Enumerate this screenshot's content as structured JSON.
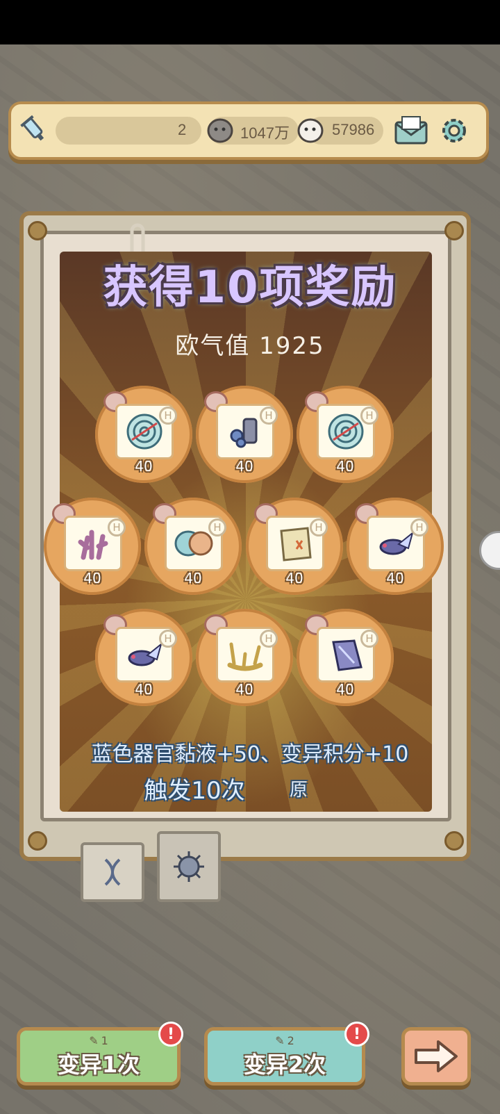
{
  "topbar": {
    "items_count": "2",
    "coins": "1047万",
    "gems": "57986"
  },
  "reward_panel": {
    "title": "获得10项奖励",
    "luck_label": "欧气值 1925",
    "rewards": [
      {
        "item": "maze-organ-icon",
        "count": "40"
      },
      {
        "item": "tree-stump-mushroom-icon",
        "count": "40"
      },
      {
        "item": "maze-organ-icon",
        "count": "40"
      },
      {
        "item": "coral-icon",
        "count": "40"
      },
      {
        "item": "brain-icon",
        "count": "40"
      },
      {
        "item": "map-scroll-icon",
        "count": "40"
      },
      {
        "item": "winged-fish-icon",
        "count": "40"
      },
      {
        "item": "winged-fish-icon",
        "count": "40"
      },
      {
        "item": "antler-icon",
        "count": "40"
      },
      {
        "item": "crystal-shard-icon",
        "count": "40"
      }
    ],
    "summary_line1": "蓝色器官黏液+50、变异积分+10",
    "summary_line2": "触发10次",
    "summary_suffix": "原"
  },
  "bottom": {
    "mutate_once_cost": "1",
    "mutate_once_label": "变异1次",
    "mutate_twice_cost": "2",
    "mutate_twice_label": "变异2次",
    "alert_mark": "!"
  },
  "colors": {
    "accent_gold": "#b78c4e",
    "reward_orange": "#e6a660",
    "alert_red": "#e44a4a"
  }
}
